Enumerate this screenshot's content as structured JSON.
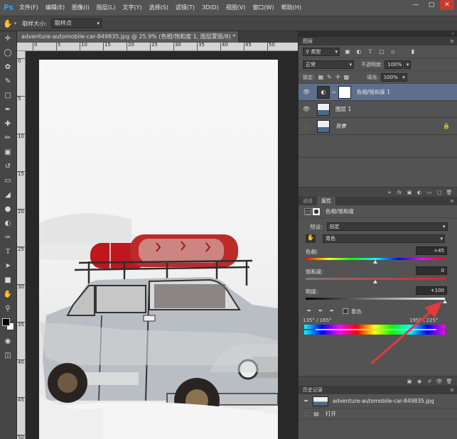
{
  "app": {
    "logo": "Ps"
  },
  "menu": [
    "文件(F)",
    "编辑(E)",
    "图像(I)",
    "图层(L)",
    "文字(Y)",
    "选择(S)",
    "滤镜(T)",
    "3D(D)",
    "视图(V)",
    "窗口(W)",
    "帮助(H)"
  ],
  "options": {
    "sample_size_label": "取样大小:",
    "sample_size_value": "取样点"
  },
  "document": {
    "tab_title": "adventure-automobile-car-849835.jpg @ 25.9% (色相/饱和度 1, 图层蒙版/8) *"
  },
  "rulers": {
    "top": [
      "0",
      "5",
      "10",
      "15",
      "20",
      "25",
      "30",
      "35",
      "40",
      "45",
      "50"
    ],
    "left": [
      "0",
      "5",
      "10",
      "15",
      "20",
      "25",
      "30",
      "35",
      "40",
      "45",
      "50"
    ]
  },
  "layers_panel": {
    "title": "图层",
    "filter_label": "类型",
    "blend_mode": "正常",
    "opacity_label": "不透明度:",
    "opacity_value": "100%",
    "lock_label": "锁定:",
    "fill_label": "填充:",
    "fill_value": "100%",
    "layers": [
      {
        "name": "色相/饱和度 1",
        "kind": "adjustment",
        "visible": true,
        "selected": true
      },
      {
        "name": "图层 1",
        "kind": "pixel",
        "visible": true,
        "selected": false
      },
      {
        "name": "背景",
        "kind": "background",
        "visible": false,
        "selected": false,
        "locked": true
      }
    ]
  },
  "properties_panel": {
    "tabs": [
      "通道",
      "属性"
    ],
    "title": "色相/饱和度",
    "preset_label": "预设:",
    "preset_value": "自定",
    "channel_value": "青色",
    "hue_label": "色相:",
    "hue_value": "+45",
    "saturation_label": "饱和度:",
    "saturation_value": "0",
    "lightness_label": "明度:",
    "lightness_value": "+100",
    "colorize_label": "着色",
    "range_left": "135° / 165°",
    "range_right": "195° \\ 225°"
  },
  "history_panel": {
    "title": "历史记录",
    "items": [
      "adventure-automobile-car-849835.jpg",
      "打开"
    ]
  },
  "colors": {
    "accent_red": "#e53a3a",
    "selected_layer": "#5d6f8c"
  },
  "slider_levels": {
    "hue": 0.5,
    "saturation": 0.5,
    "lightness": 1.0
  }
}
